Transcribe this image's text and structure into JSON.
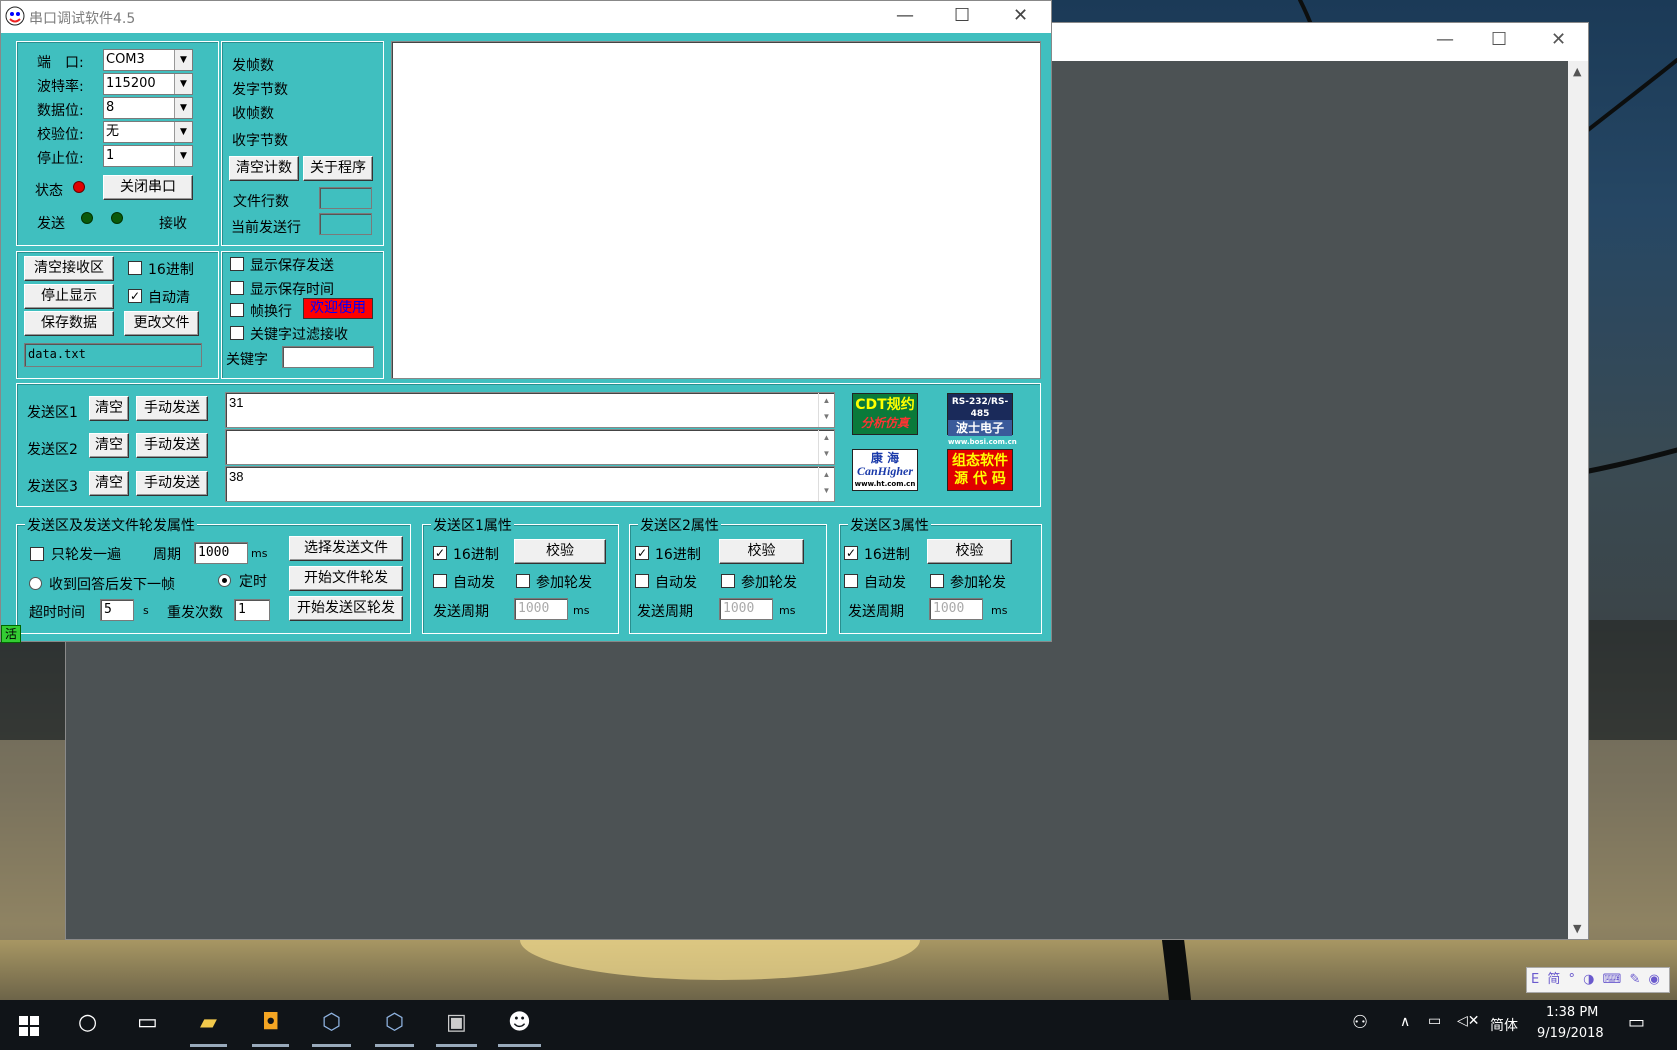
{
  "window": {
    "title": "串口调试软件4.5",
    "minimize": "—",
    "maximize": "☐",
    "close": "✕"
  },
  "port": {
    "port_label": "端　口:",
    "port_value": "COM3",
    "baud_label": "波特率:",
    "baud_value": "115200",
    "databits_label": "数据位:",
    "databits_value": "8",
    "parity_label": "校验位:",
    "parity_value": "无",
    "stopbits_label": "停止位:",
    "stopbits_value": "1",
    "status_label": "状态",
    "close_port_btn": "关闭串口",
    "send_label": "发送",
    "recv_label": "接收"
  },
  "counters": {
    "sent_frames": "发帧数",
    "sent_bytes": "发字节数",
    "recv_frames": "收帧数",
    "recv_bytes": "收字节数",
    "clear_count_btn": "清空计数",
    "about_btn": "关于程序",
    "file_lines": "文件行数",
    "current_line": "当前发送行"
  },
  "recv_ctrl": {
    "clear_btn": "清空接收区",
    "hex_label": "16进制",
    "stop_btn": "停止显示",
    "autoclear_label": "自动清",
    "save_btn": "保存数据",
    "change_file_btn": "更改文件",
    "file_name": "data.txt"
  },
  "display_opts": {
    "show_save_send": "显示保存发送",
    "show_save_time": "显示保存时间",
    "frame_newline": "帧换行",
    "welcome": "欢迎使用",
    "keyword_filter": "关键字过滤接收",
    "keyword_label": "关键字"
  },
  "send_areas": [
    {
      "label": "发送区1",
      "clear": "清空",
      "send": "手动发送",
      "text": "31"
    },
    {
      "label": "发送区2",
      "clear": "清空",
      "send": "手动发送",
      "text": ""
    },
    {
      "label": "发送区3",
      "clear": "清空",
      "send": "手动发送",
      "text": "38"
    }
  ],
  "ads": {
    "cdt_line1": "CDT规约",
    "cdt_line2": "分析仿真",
    "bosi_top": "RS-232/RS-485",
    "bosi_mid": "波士电子",
    "bosi_url": "www.bosi.com.cn",
    "kanghai_line1": "康 海",
    "kanghai_line2": "CanHigher",
    "kanghai_url": "www.ht.com.cn",
    "zutai_line1": "组态软件",
    "zutai_line2": "源 代 码"
  },
  "rotate": {
    "caption": "发送区及发送文件轮发属性",
    "only_once": "只轮发一遍",
    "period_label": "周期",
    "period_value": "1000",
    "ms": "ms",
    "select_file_btn": "选择发送文件",
    "on_reply": "收到回答后发下一帧",
    "timed": "定时",
    "start_file_btn": "开始文件轮发",
    "timeout_label": "超时时间",
    "timeout_value": "5",
    "s": "s",
    "retry_label": "重发次数",
    "retry_value": "1",
    "start_area_btn": "开始发送区轮发"
  },
  "area_props": [
    {
      "caption": "发送区1属性",
      "hex": "16进制",
      "check_btn": "校验",
      "auto": "自动发",
      "join": "参加轮发",
      "period_label": "发送周期",
      "period_value": "1000",
      "ms": "ms"
    },
    {
      "caption": "发送区2属性",
      "hex": "16进制",
      "check_btn": "校验",
      "auto": "自动发",
      "join": "参加轮发",
      "period_label": "发送周期",
      "period_value": "1000",
      "ms": "ms"
    },
    {
      "caption": "发送区3属性",
      "hex": "16进制",
      "check_btn": "校验",
      "auto": "自动发",
      "join": "参加轮发",
      "period_label": "发送周期",
      "period_value": "1000",
      "ms": "ms"
    }
  ],
  "status_tag": "活",
  "colors": {
    "app_bg": "#40bfbf",
    "led_red": "#e00000",
    "led_green": "#0a5a0a",
    "welcome_bg": "#ff0000",
    "welcome_fg": "#0000ff"
  },
  "ime_bar": "E 简 ° ◑ ⌨ ✎ ◉",
  "taskbar": {
    "lang": "简体",
    "time": "1:38 PM",
    "date": "9/19/2018"
  }
}
